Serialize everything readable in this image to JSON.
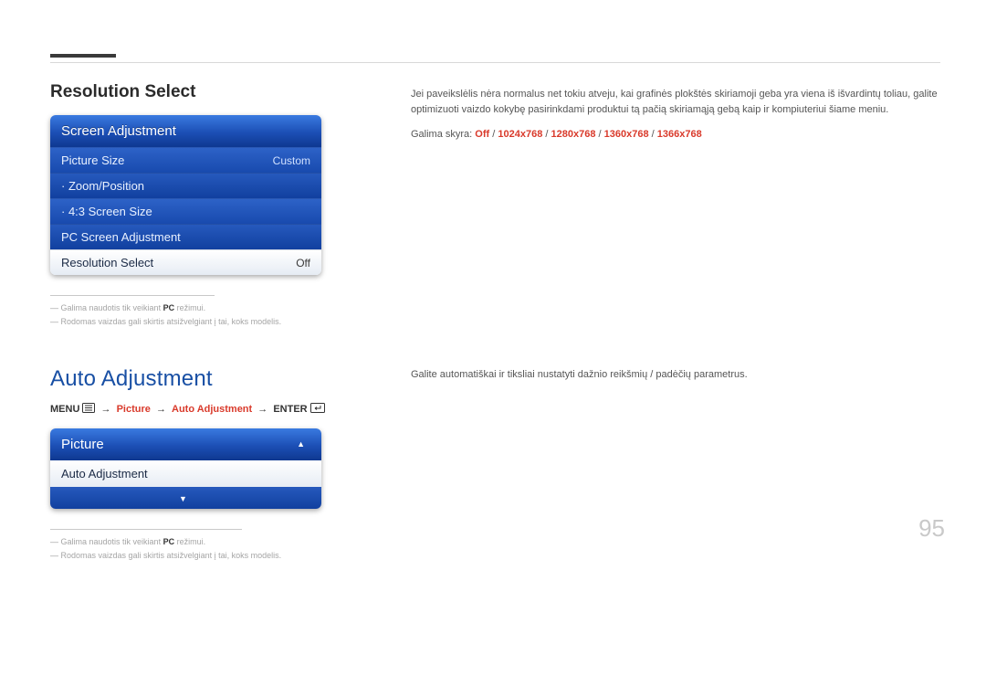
{
  "page_number": "95",
  "section1": {
    "title": "Resolution Select",
    "panel_header": "Screen Adjustment",
    "rows": [
      {
        "label": "Picture Size",
        "value": "Custom"
      },
      {
        "label": "· Zoom/Position",
        "value": ""
      },
      {
        "label": "· 4:3 Screen Size",
        "value": ""
      },
      {
        "label": "PC Screen Adjustment",
        "value": ""
      },
      {
        "label": "Resolution Select",
        "value": "Off"
      }
    ],
    "footnotes": {
      "n1_pre": "Galima naudotis tik veikiant ",
      "n1_bold": "PC",
      "n1_post": " režimui.",
      "n2": "Rodomas vaizdas gali skirtis atsižvelgiant į tai, koks modelis."
    },
    "body_p1": "Jei paveikslėlis nėra normalus net tokiu atveju, kai grafinės plokštės skiriamoji geba yra viena iš išvardintų toliau, galite optimizuoti vaizdo kokybę pasirinkdami produktui tą pačią skiriamąją gebą kaip ir kompiuteriui šiame meniu.",
    "opts_label": "Galima skyra: ",
    "opts": [
      "Off",
      "1024x768",
      "1280x768",
      "1360x768",
      "1366x768"
    ]
  },
  "section2": {
    "title": "Auto Adjustment",
    "body": "Galite automatiškai ir tiksliai nustatyti dažnio reikšmių / padėčių parametrus.",
    "path": {
      "menu": "MENU",
      "step2": "Picture",
      "step3": "Auto Adjustment",
      "enter": "ENTER"
    },
    "panel_header": "Picture",
    "row_label": "Auto Adjustment",
    "footnotes": {
      "n1_pre": "Galima naudotis tik veikiant ",
      "n1_bold": "PC",
      "n1_post": " režimui.",
      "n2": "Rodomas vaizdas gali skirtis atsižvelgiant į tai, koks modelis."
    }
  }
}
